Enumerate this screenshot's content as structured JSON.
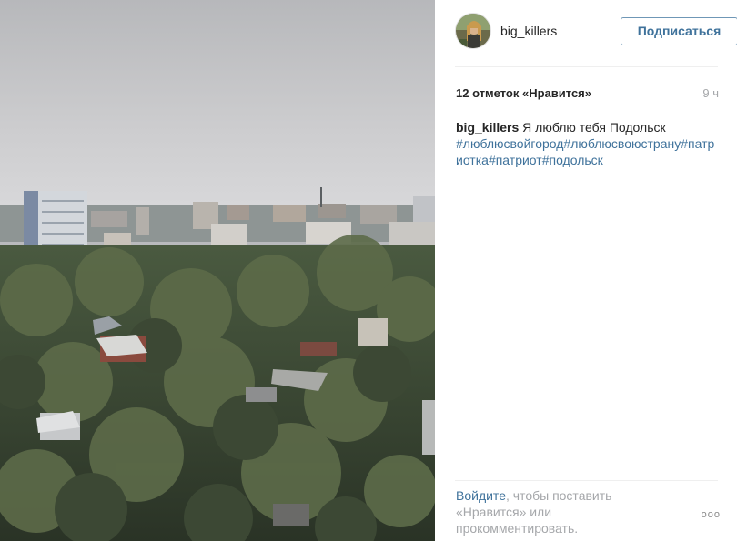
{
  "post": {
    "username": "big_killers",
    "follow_label": "Подписаться",
    "likes": "12 отметок «Нравится»",
    "time": "9 ч",
    "caption_text": " Я люблю тебя Подольск",
    "hashtags": [
      "#люблюсвойгород",
      "#люблюсвоюстрану",
      "#патриотка",
      "#патриот",
      "#подольск"
    ],
    "login_link": "Войдите",
    "login_rest": ", чтобы поставить «Нравится» или прокомментировать.",
    "more_label": "ooo"
  },
  "photo": {
    "subject": "city-skyline"
  },
  "colors": {
    "link": "#3f729b",
    "muted": "#a5a7aa",
    "text": "#262626"
  }
}
